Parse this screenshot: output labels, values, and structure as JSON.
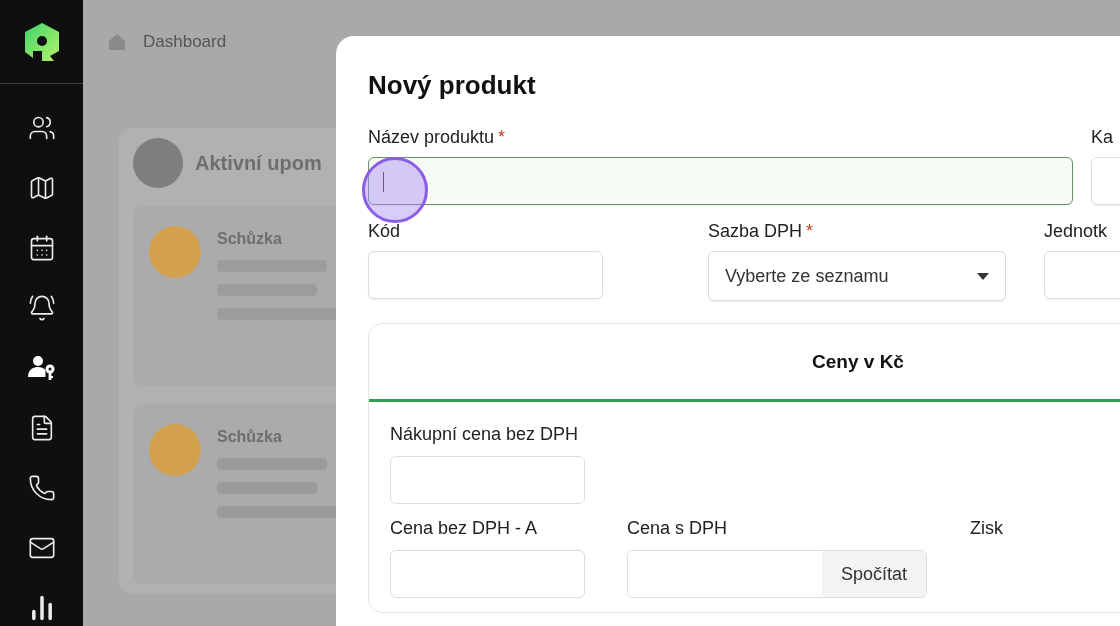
{
  "sidebar": {
    "items": [
      {
        "kind": "contacts",
        "selected": false
      },
      {
        "kind": "map",
        "selected": false
      },
      {
        "kind": "calendar",
        "selected": false
      },
      {
        "kind": "alarm",
        "selected": false
      },
      {
        "kind": "user-key",
        "selected": true
      },
      {
        "kind": "document",
        "selected": false
      },
      {
        "kind": "phone",
        "selected": false
      },
      {
        "kind": "mail",
        "selected": false
      },
      {
        "kind": "stats",
        "selected": false
      }
    ]
  },
  "background": {
    "breadcrumb": "Dashboard",
    "panel_title": "Aktivní upom",
    "cards": [
      {
        "title": "Schůzka"
      },
      {
        "title": "Schůzka"
      }
    ]
  },
  "modal": {
    "title": "Nový produkt",
    "fields": [
      {
        "kind": "input",
        "label": "Název produktu",
        "required_mark": "*",
        "focused": true
      },
      {
        "kind": "input",
        "label": "Ka",
        "focused": false
      },
      {
        "kind": "input",
        "label": "Kód",
        "focused": false
      },
      {
        "kind": "select",
        "label": "Sazba DPH",
        "required_mark": "*",
        "placeholder": "Vyberte ze seznamu",
        "focused": false
      },
      {
        "kind": "input",
        "label": "Jednotk",
        "focused": false
      }
    ],
    "prices": {
      "tab": "Ceny v Kč",
      "purchase_label": "Nákupní cena bez DPH",
      "rows": [
        {
          "price_label": "Cena bez DPH - A",
          "gross_label": "Cena s DPH",
          "button": "Spočítat",
          "profit_label": "Zisk"
        }
      ]
    }
  }
}
